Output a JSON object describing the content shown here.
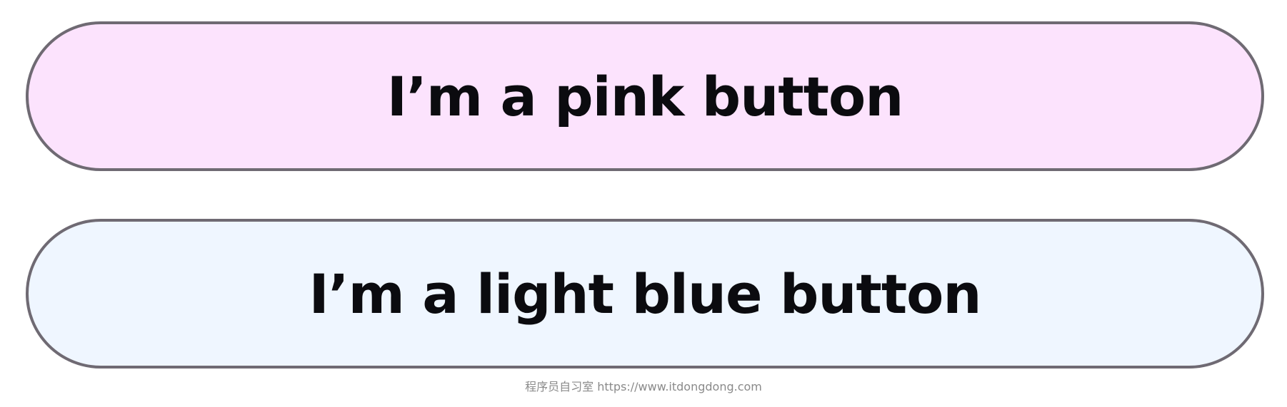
{
  "buttons": {
    "pink": {
      "label": "I’m a pink button",
      "background": "#fce3fd",
      "border": "#6f6a73"
    },
    "light_blue": {
      "label": "I’m a light blue button",
      "background": "#eff6ff",
      "border": "#6f6a73"
    }
  },
  "watermark": {
    "text": "程序员自习室 https://www.itdongdong.com"
  }
}
